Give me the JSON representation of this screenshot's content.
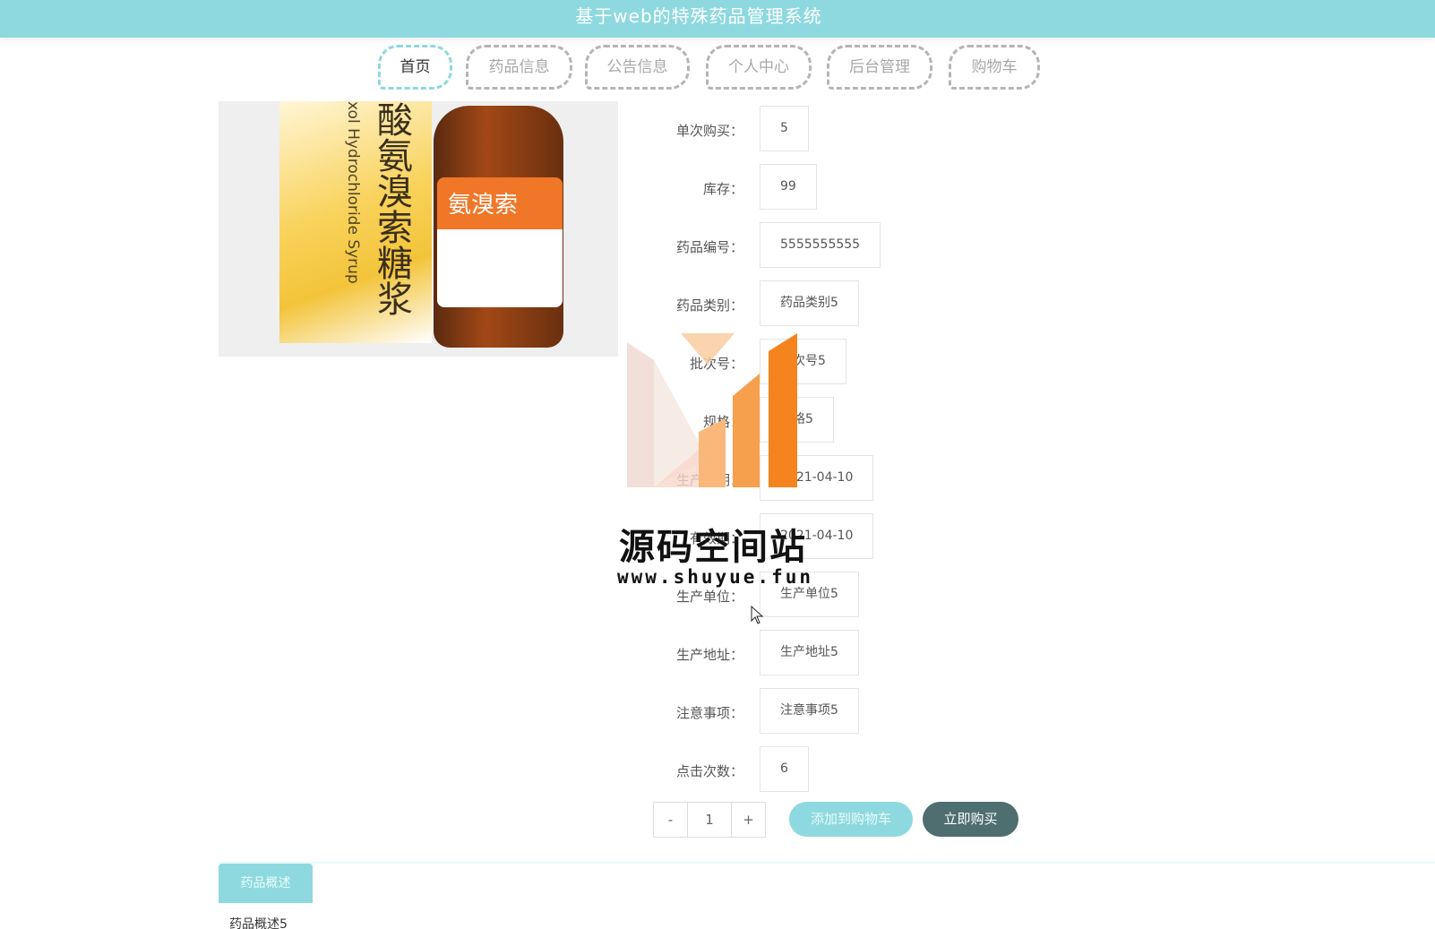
{
  "header": {
    "title": "基于web的特殊药品管理系统"
  },
  "nav": {
    "items": [
      {
        "label": "首页",
        "active": true
      },
      {
        "label": "药品信息",
        "active": false
      },
      {
        "label": "公告信息",
        "active": false
      },
      {
        "label": "个人中心",
        "active": false
      },
      {
        "label": "后台管理",
        "active": false
      },
      {
        "label": "购物车",
        "active": false
      }
    ]
  },
  "product_image": {
    "box_text": "酸氨溴索糖浆",
    "box_sub": "xol Hydrochloride Syrup",
    "label_text": "氨溴索"
  },
  "fields": [
    {
      "label": "单次购买：",
      "value": "5"
    },
    {
      "label": "库存：",
      "value": "99"
    },
    {
      "label": "药品编号：",
      "value": "5555555555"
    },
    {
      "label": "药品类别：",
      "value": "药品类别5"
    },
    {
      "label": "批次号：",
      "value": "批次号5"
    },
    {
      "label": "规格：",
      "value": "规格5"
    },
    {
      "label": "生产日期：",
      "value": "2021-04-10"
    },
    {
      "label": "有效期：",
      "value": "2021-04-10"
    },
    {
      "label": "生产单位：",
      "value": "生产单位5"
    },
    {
      "label": "生产地址：",
      "value": "生产地址5"
    },
    {
      "label": "注意事项：",
      "value": "注意事项5"
    },
    {
      "label": "点击次数：",
      "value": "6"
    }
  ],
  "quantity": {
    "minus": "-",
    "value": "1",
    "plus": "+"
  },
  "buttons": {
    "add_to_cart": "添加到购物车",
    "buy_now": "立即购买"
  },
  "tabs": {
    "description": "药品概述"
  },
  "description": {
    "text": "药品概述5"
  },
  "watermark": {
    "title": "源码空间站",
    "url": "www.shuyue.fun"
  },
  "colors": {
    "accent": "#8ed9df",
    "buy_button": "#4f6e70",
    "watermark_orange": "#f5841f"
  }
}
